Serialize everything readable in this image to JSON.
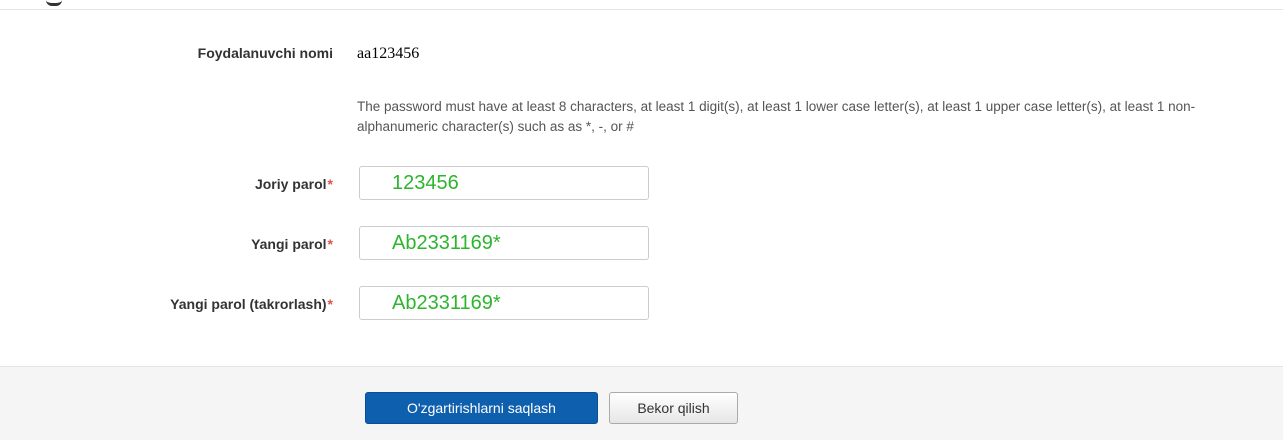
{
  "form": {
    "username": {
      "label": "Foydalanuvchi nomi",
      "value": "aa123456"
    },
    "password_policy": "The password must have at least 8 characters, at least 1 digit(s), at least 1 lower case letter(s), at least 1 upper case letter(s), at least 1 non-alphanumeric character(s) such as as *, -, or #",
    "current_password": {
      "label": "Joriy parol",
      "value": "123456"
    },
    "new_password": {
      "label": "Yangi parol",
      "value": "Ab2331169*"
    },
    "confirm_password": {
      "label": "Yangi parol (takrorlash)",
      "value": "Ab2331169*"
    },
    "required_marker": "*"
  },
  "actions": {
    "save_label": "O'zgartirishlarni saqlash",
    "cancel_label": "Bekor qilish"
  },
  "colors": {
    "required": "#d9534f",
    "input_text": "#2db52d",
    "primary_button": "#0f5faf"
  }
}
